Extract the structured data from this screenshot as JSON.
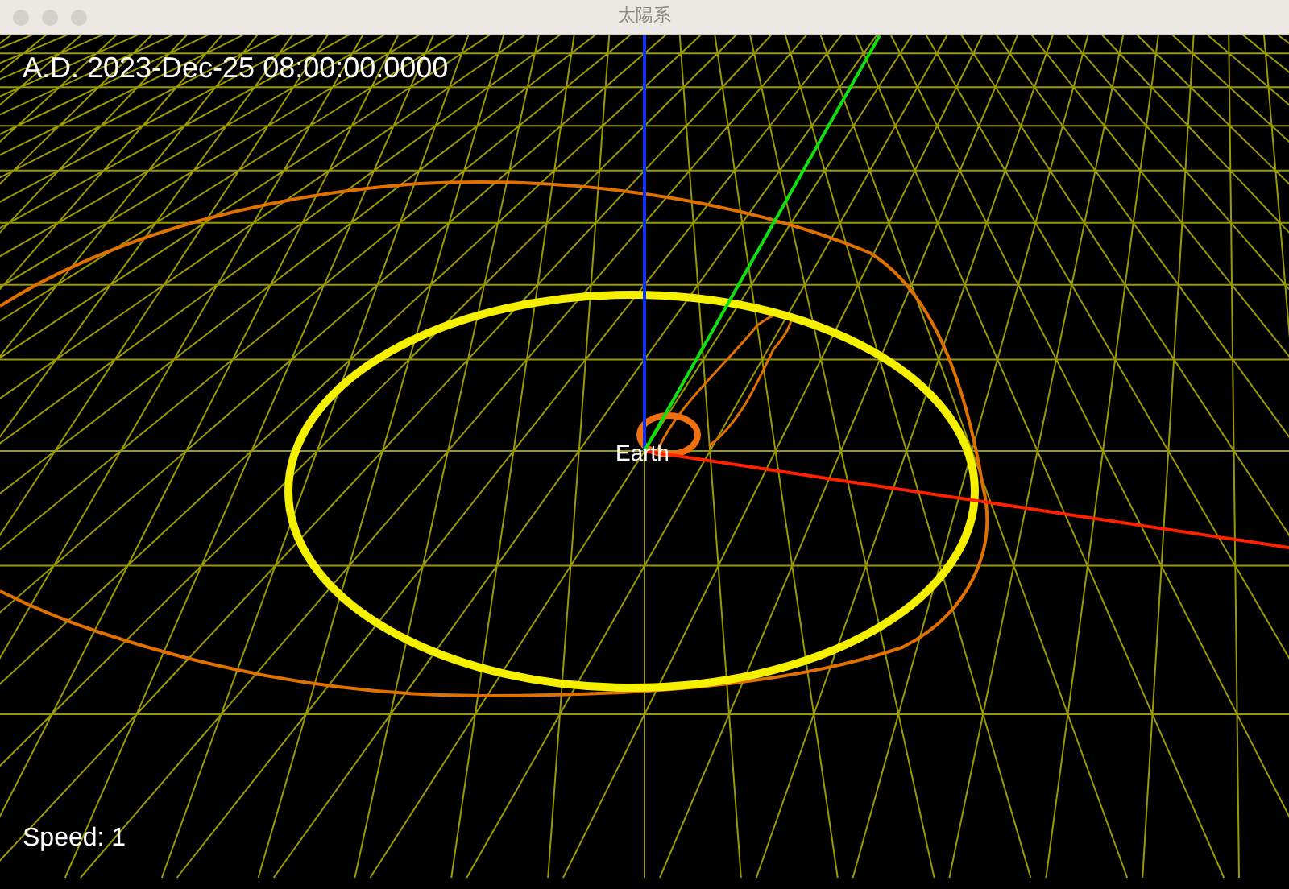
{
  "window": {
    "title": "太陽系"
  },
  "scene": {
    "date_time": "A.D. 2023-Dec-25 08:00:00.0000",
    "speed": "Speed: 1",
    "bodies": [
      {
        "label": "Earth"
      }
    ]
  }
}
